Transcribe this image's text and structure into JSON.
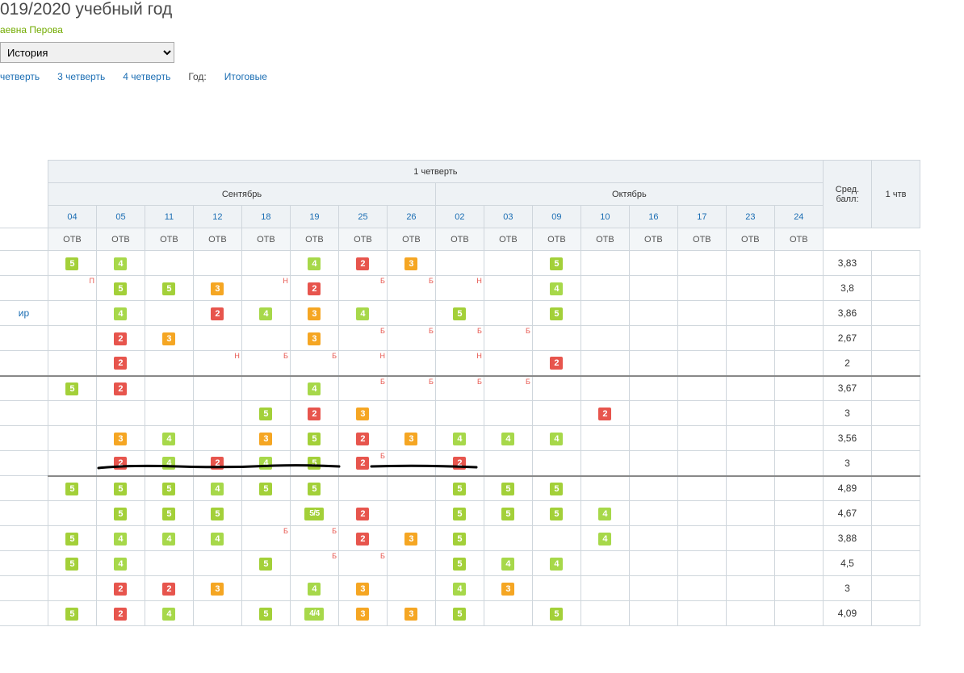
{
  "header": {
    "year_title": "019/2020 учебный год",
    "teacher_fragment": "аевна Перова",
    "subject_selected": "История",
    "tabs": {
      "q2": "четверть",
      "q3": "3 четверть",
      "q4": "4 четверть",
      "year_label": "Год:",
      "final": "Итоговые"
    }
  },
  "table": {
    "quarter_header": "1 четверть",
    "months": {
      "sep": "Сентябрь",
      "oct": "Октябрь"
    },
    "avg_label": "Сред. балл:",
    "q1_label": "1 чтв",
    "otv": "ОТВ",
    "dates": [
      "04",
      "05",
      "11",
      "12",
      "18",
      "19",
      "25",
      "26",
      "02",
      "03",
      "09",
      "10",
      "16",
      "17",
      "23",
      "24"
    ],
    "rows": [
      {
        "name": "",
        "cells": [
          {
            "v": "5"
          },
          {
            "v": "4"
          },
          null,
          null,
          null,
          {
            "v": "4"
          },
          {
            "v": "2"
          },
          {
            "v": "3"
          },
          null,
          null,
          {
            "v": "5"
          },
          null,
          null,
          null,
          null,
          null
        ],
        "avg": "3,83"
      },
      {
        "name": "",
        "cells": [
          {
            "n": "П"
          },
          {
            "v": "5"
          },
          {
            "v": "5"
          },
          {
            "v": "3"
          },
          {
            "n": "Н"
          },
          {
            "v": "2"
          },
          {
            "n": "Б"
          },
          {
            "n": "Б"
          },
          {
            "n": "Н"
          },
          null,
          {
            "v": "4"
          },
          null,
          null,
          null,
          null,
          null
        ],
        "avg": "3,8"
      },
      {
        "name": "ир",
        "cells": [
          null,
          {
            "v": "4"
          },
          null,
          {
            "v": "2"
          },
          {
            "v": "4"
          },
          {
            "v": "3"
          },
          {
            "v": "4"
          },
          null,
          {
            "v": "5"
          },
          null,
          {
            "v": "5"
          },
          null,
          null,
          null,
          null,
          null
        ],
        "avg": "3,86"
      },
      {
        "name": "",
        "cells": [
          null,
          {
            "v": "2"
          },
          {
            "v": "3"
          },
          null,
          null,
          {
            "v": "3"
          },
          {
            "n": "Б"
          },
          {
            "n": "Б"
          },
          {
            "n": "Б"
          },
          {
            "n": "Б"
          },
          null,
          null,
          null,
          null,
          null,
          null
        ],
        "avg": "2,67"
      },
      {
        "name": "",
        "cells": [
          null,
          {
            "v": "2"
          },
          null,
          {
            "n": "Н"
          },
          {
            "n": "Б"
          },
          {
            "n": "Б"
          },
          {
            "n": "Н"
          },
          null,
          {
            "n": "Н"
          },
          null,
          {
            "v": "2"
          },
          null,
          null,
          null,
          null,
          null
        ],
        "avg": "2",
        "sep": true
      },
      {
        "name": "",
        "cells": [
          {
            "v": "5"
          },
          {
            "v": "2"
          },
          null,
          null,
          null,
          {
            "v": "4"
          },
          {
            "n": "Б"
          },
          {
            "n": "Б"
          },
          {
            "n": "Б"
          },
          {
            "n": "Б"
          },
          null,
          null,
          null,
          null,
          null,
          null
        ],
        "avg": "3,67"
      },
      {
        "name": "",
        "cells": [
          null,
          null,
          null,
          null,
          {
            "v": "5"
          },
          {
            "v": "2"
          },
          {
            "v": "3"
          },
          null,
          null,
          null,
          null,
          {
            "v": "2"
          },
          null,
          null,
          null,
          null
        ],
        "avg": "3"
      },
      {
        "name": "",
        "cells": [
          null,
          {
            "v": "3"
          },
          {
            "v": "4"
          },
          null,
          {
            "v": "3"
          },
          {
            "v": "5"
          },
          {
            "v": "2"
          },
          {
            "v": "3"
          },
          {
            "v": "4"
          },
          {
            "v": "4"
          },
          {
            "v": "4"
          },
          null,
          null,
          null,
          null,
          null
        ],
        "avg": "3,56"
      },
      {
        "name": "",
        "cells": [
          null,
          {
            "v": "2"
          },
          {
            "v": "4"
          },
          {
            "v": "2"
          },
          {
            "v": "4"
          },
          {
            "v": "5"
          },
          {
            "v": "2",
            "n": "Б"
          },
          null,
          {
            "v": "2"
          },
          null,
          null,
          null,
          null,
          null,
          null,
          null
        ],
        "avg": "3"
      },
      {
        "name": "",
        "cells": [
          {
            "v": "5"
          },
          {
            "v": "5"
          },
          {
            "v": "5"
          },
          {
            "v": "4"
          },
          {
            "v": "5"
          },
          {
            "v": "5"
          },
          null,
          null,
          {
            "v": "5"
          },
          {
            "v": "5"
          },
          {
            "v": "5"
          },
          null,
          null,
          null,
          null,
          null
        ],
        "avg": "4,89",
        "sep_above": true
      },
      {
        "name": "",
        "cells": [
          null,
          {
            "v": "5"
          },
          {
            "v": "5"
          },
          {
            "v": "5"
          },
          null,
          {
            "v": "5/5",
            "dbl": true
          },
          {
            "v": "2"
          },
          null,
          {
            "v": "5"
          },
          {
            "v": "5"
          },
          {
            "v": "5"
          },
          {
            "v": "4"
          },
          null,
          null,
          null,
          null
        ],
        "avg": "4,67"
      },
      {
        "name": "",
        "cells": [
          {
            "v": "5"
          },
          {
            "v": "4"
          },
          {
            "v": "4"
          },
          {
            "v": "4"
          },
          {
            "n": "Б"
          },
          {
            "n": "Б"
          },
          {
            "v": "2"
          },
          {
            "v": "3"
          },
          {
            "v": "5"
          },
          null,
          null,
          {
            "v": "4"
          },
          null,
          null,
          null,
          null
        ],
        "avg": "3,88"
      },
      {
        "name": "",
        "cells": [
          {
            "v": "5"
          },
          {
            "v": "4"
          },
          null,
          null,
          {
            "v": "5"
          },
          {
            "n": "Б"
          },
          {
            "n": "Б"
          },
          null,
          {
            "v": "5"
          },
          {
            "v": "4"
          },
          {
            "v": "4"
          },
          null,
          null,
          null,
          null,
          null
        ],
        "avg": "4,5"
      },
      {
        "name": "",
        "cells": [
          null,
          {
            "v": "2"
          },
          {
            "v": "2"
          },
          {
            "v": "3"
          },
          null,
          {
            "v": "4"
          },
          {
            "v": "3"
          },
          null,
          {
            "v": "4"
          },
          {
            "v": "3"
          },
          null,
          null,
          null,
          null,
          null,
          null
        ],
        "avg": "3"
      },
      {
        "name": "",
        "cells": [
          {
            "v": "5"
          },
          {
            "v": "2"
          },
          {
            "v": "4"
          },
          null,
          {
            "v": "5"
          },
          {
            "v": "4/4",
            "dbl": true
          },
          {
            "v": "3"
          },
          {
            "v": "3"
          },
          {
            "v": "5"
          },
          null,
          {
            "v": "5"
          },
          null,
          null,
          null,
          null,
          null
        ],
        "avg": "4,09"
      }
    ]
  }
}
